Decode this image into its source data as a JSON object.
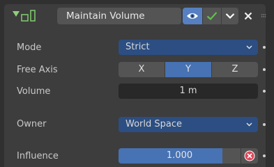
{
  "header": {
    "name": "Maintain Volume",
    "icons": {
      "collapse": "disclosure-triangle-down-icon",
      "constraint": "maintain-volume-constraint-icon",
      "visibility": "eye-icon",
      "enabled": "checkmark-icon",
      "menu": "chevron-down-icon",
      "delete": "close-x-icon",
      "drag": "grip-dots-icon"
    }
  },
  "properties": {
    "mode": {
      "label": "Mode",
      "value": "Strict"
    },
    "free_axis": {
      "label": "Free Axis",
      "options": [
        "X",
        "Y",
        "Z"
      ],
      "selected": "Y"
    },
    "volume": {
      "label": "Volume",
      "value": "1 m"
    },
    "owner": {
      "label": "Owner",
      "value": "World Space"
    },
    "influence": {
      "label": "Influence",
      "value": "1.000",
      "fraction": 0.85
    }
  },
  "colors": {
    "accent": "#4772b3",
    "select_bg": "#2c4e82",
    "panel": "#3d3d3d",
    "background": "#303030",
    "check": "#5ec248",
    "reset": "#e0455a"
  }
}
